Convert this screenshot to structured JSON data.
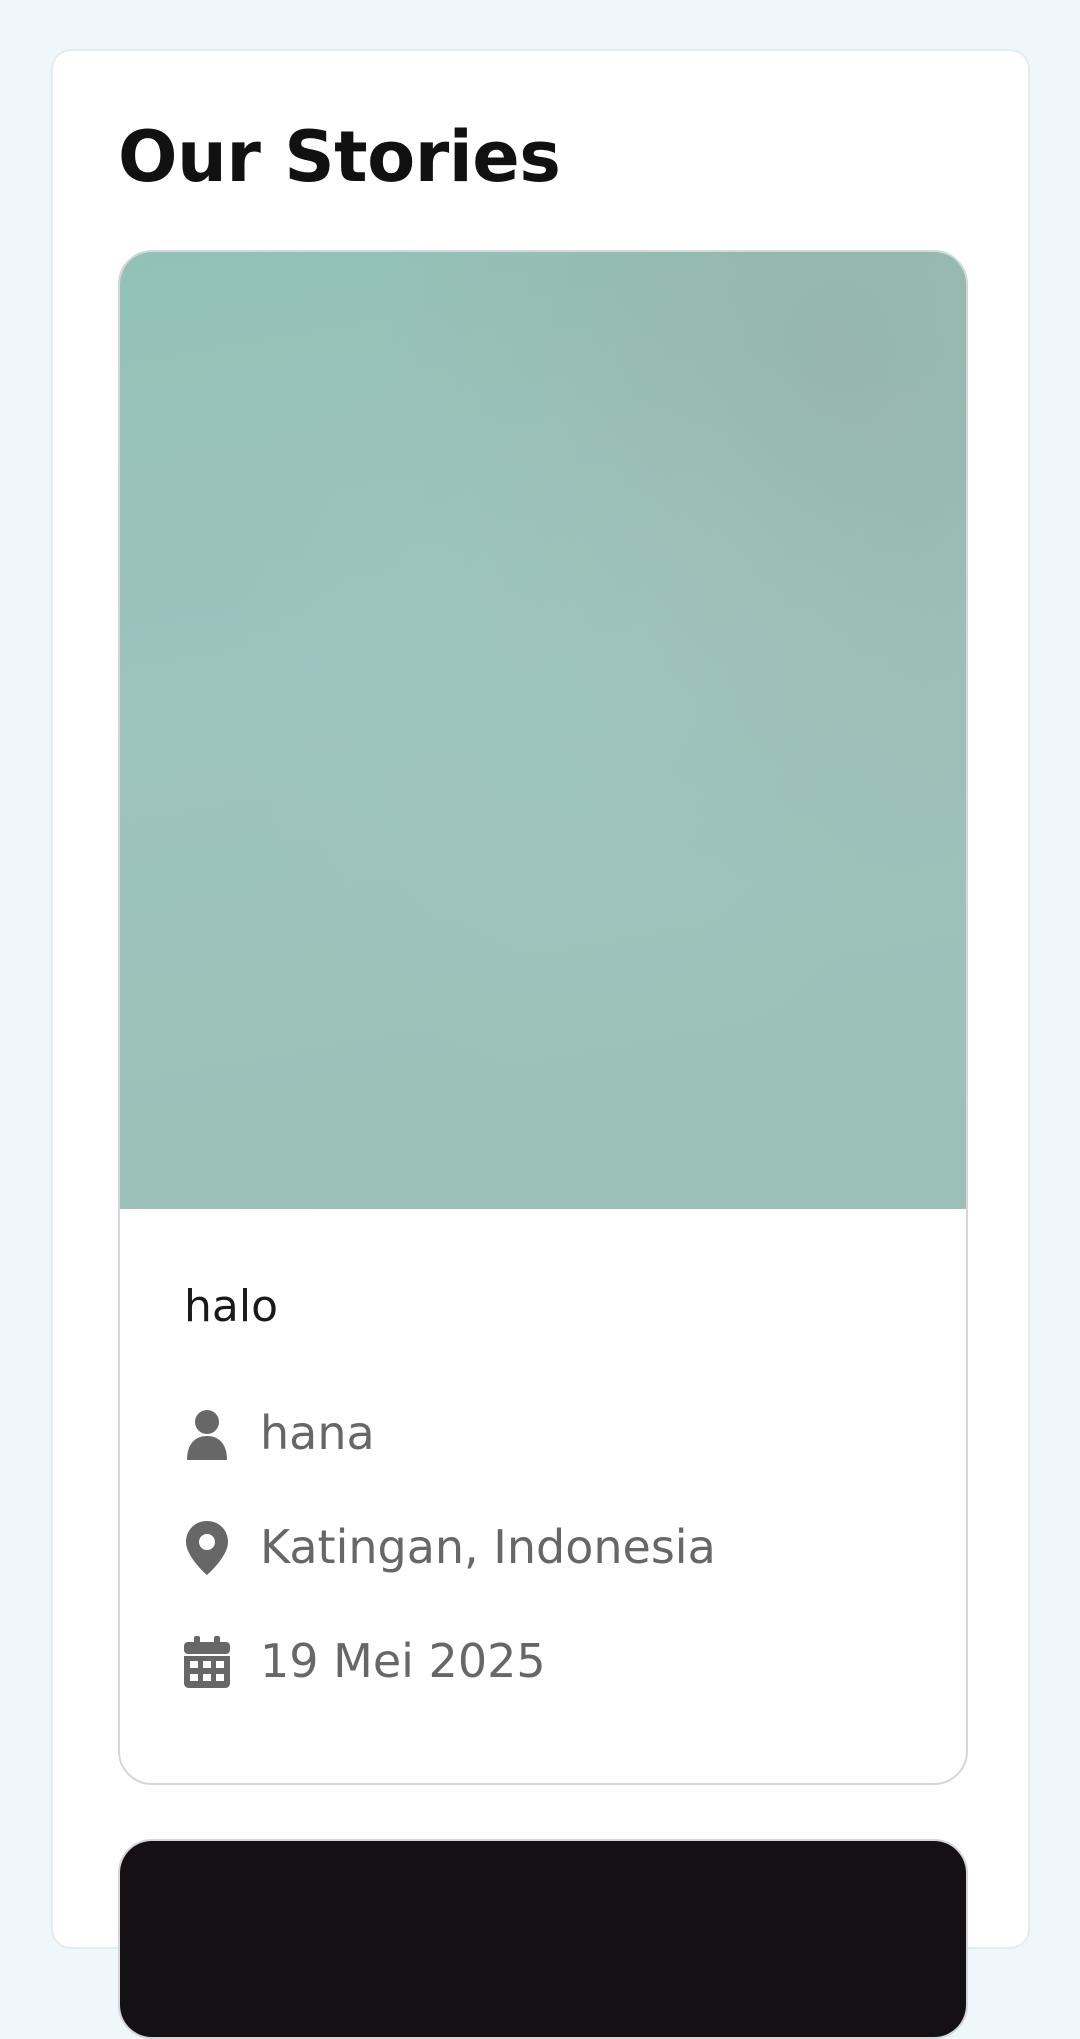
{
  "page": {
    "title": "Our Stories"
  },
  "stories": [
    {
      "description": "halo",
      "author": "hana",
      "location": "Katingan, Indonesia",
      "date": "19 Mei 2025",
      "icons": {
        "author": "user-icon",
        "location": "map-pin-icon",
        "date": "calendar-icon"
      },
      "image_tone": "#9dc3bd"
    },
    {
      "image_tone": "#141014"
    }
  ],
  "colors": {
    "background": "#eef7f9",
    "panel": "#ffffff",
    "title_text": "#111111",
    "meta_text": "#676767"
  }
}
